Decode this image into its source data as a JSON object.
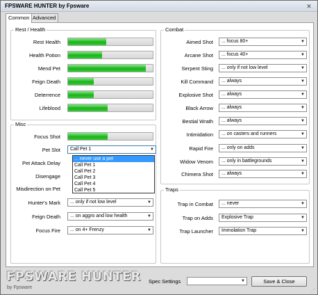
{
  "window": {
    "title": "FPSWARE HUNTER by Fpsware",
    "close_glyph": "✕"
  },
  "tabs": [
    {
      "label": "Common",
      "active": true
    },
    {
      "label": "Advanced",
      "active": false
    }
  ],
  "rest_health": {
    "title": "Rest / Health",
    "rows": [
      {
        "label": "Rest Health",
        "fill": 0.45
      },
      {
        "label": "Health Potion",
        "fill": 0.4
      },
      {
        "label": "Mend Pet",
        "fill": 0.92
      },
      {
        "label": "Feign Death",
        "fill": 0.3
      },
      {
        "label": "Deterrence",
        "fill": 0.3
      },
      {
        "label": "Lifeblood",
        "fill": 0.47
      }
    ]
  },
  "misc": {
    "title": "Misc",
    "focus_shot": {
      "label": "Focus Shot",
      "fill": 0.47
    },
    "pet_slot": {
      "label": "Pet Slot",
      "value": "Call Pet 1"
    },
    "pet_attack_delay": {
      "label": "Pet Attack Delay"
    },
    "disengage": {
      "label": "Disengage"
    },
    "misdirection": {
      "label": "Misdirection on Pet"
    },
    "hunters_mark": {
      "label": "Hunter's Mark",
      "value": "... only if not low level"
    },
    "feign_death": {
      "label": "Feign Death",
      "value": "... on aggro and low health"
    },
    "focus_fire": {
      "label": "Focus Fire",
      "value": "... on 4+ Frenzy"
    },
    "dropdown_options": [
      "... never use a pet",
      "Call Pet 1",
      "Call Pet 2",
      "Call Pet 3",
      "Call Pet 4",
      "Call Pet 5"
    ]
  },
  "combat": {
    "title": "Combat",
    "rows": [
      {
        "label": "Aimed Shot",
        "value": "... focus 80+"
      },
      {
        "label": "Arcane Shot",
        "value": "... focus 40+"
      },
      {
        "label": "Serpent Sting",
        "value": "... only if not low level"
      },
      {
        "label": "Kill Command",
        "value": "... always"
      },
      {
        "label": "Explosive Shot",
        "value": "... always"
      },
      {
        "label": "Black Arrow",
        "value": "... always"
      },
      {
        "label": "Bestial Wrath",
        "value": "... always"
      },
      {
        "label": "Intimidation",
        "value": "... on casters and runners"
      },
      {
        "label": "Rapid Fire",
        "value": "... only on adds"
      },
      {
        "label": "Widow Venom",
        "value": "... only in battlegrounds"
      },
      {
        "label": "Chimera Shot",
        "value": "... always"
      }
    ]
  },
  "traps": {
    "title": "Traps",
    "rows": [
      {
        "label": "Trap in Combat",
        "value": "... never"
      },
      {
        "label": "Trap on Adds",
        "value": "Explosive Trap"
      },
      {
        "label": "Trap Launcher",
        "value": "Immolation Trap"
      }
    ]
  },
  "footer": {
    "logo_text": "FPSWARE HUNTER",
    "logo_sub": "by Fpsware",
    "spec_label": "Spec Settings",
    "spec_value": "",
    "save_button": "Save & Close",
    "arrow_glyph": "▼"
  }
}
